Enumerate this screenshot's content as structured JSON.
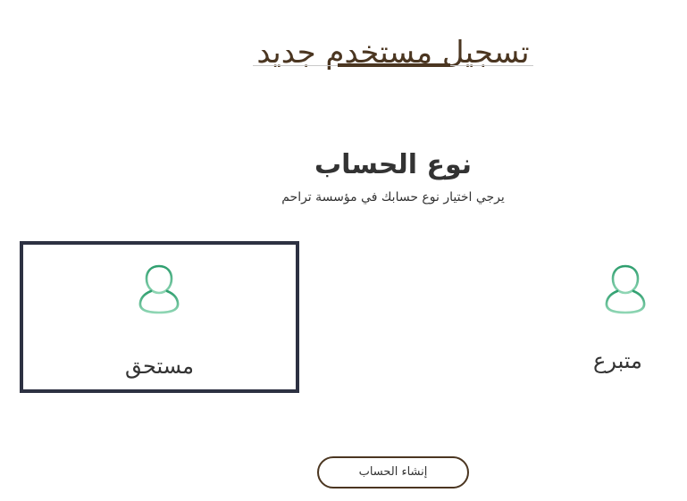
{
  "header": {
    "title": "تسجيل مستخدم جديد"
  },
  "account_type": {
    "title": "نوع الحساب",
    "subtitle": "يرجي اختيار نوع حسابك في مؤسسة تراحم",
    "options": [
      {
        "label": "مستحق",
        "icon": "user-icon",
        "selected": true
      },
      {
        "label": "متبرع",
        "icon": "user-icon",
        "selected": false
      }
    ]
  },
  "actions": {
    "create_label": "إنشاء الحساب"
  },
  "colors": {
    "brand_brown": "#4b3621",
    "icon_green": "#3aa978",
    "selected_border": "#2d3142"
  }
}
